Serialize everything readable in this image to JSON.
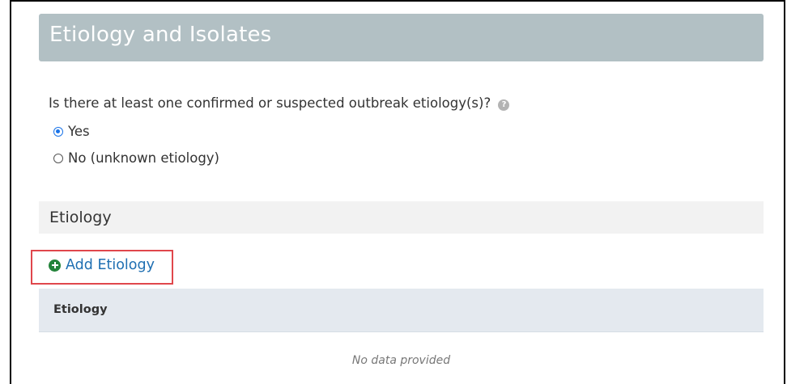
{
  "section": {
    "title": "Etiology and Isolates"
  },
  "question": {
    "text": "Is there at least one confirmed or suspected outbreak etiology(s)?",
    "help_icon": "question-circle-icon",
    "help_glyph": "?"
  },
  "options": [
    {
      "label": "Yes",
      "checked": true
    },
    {
      "label": "No (unknown etiology)",
      "checked": false
    }
  ],
  "etiology": {
    "subsection_title": "Etiology",
    "add_button_label": "Add Etiology",
    "add_icon": "plus-circle-icon",
    "table": {
      "columns": [
        "Etiology"
      ],
      "rows": [],
      "empty_text": "No data provided"
    }
  },
  "colors": {
    "header_bg": "#b2c0c4",
    "link": "#1f6fb2",
    "add_icon": "#23833a",
    "highlight_box": "#e0474c",
    "radio_checked": "#1a73e8"
  }
}
